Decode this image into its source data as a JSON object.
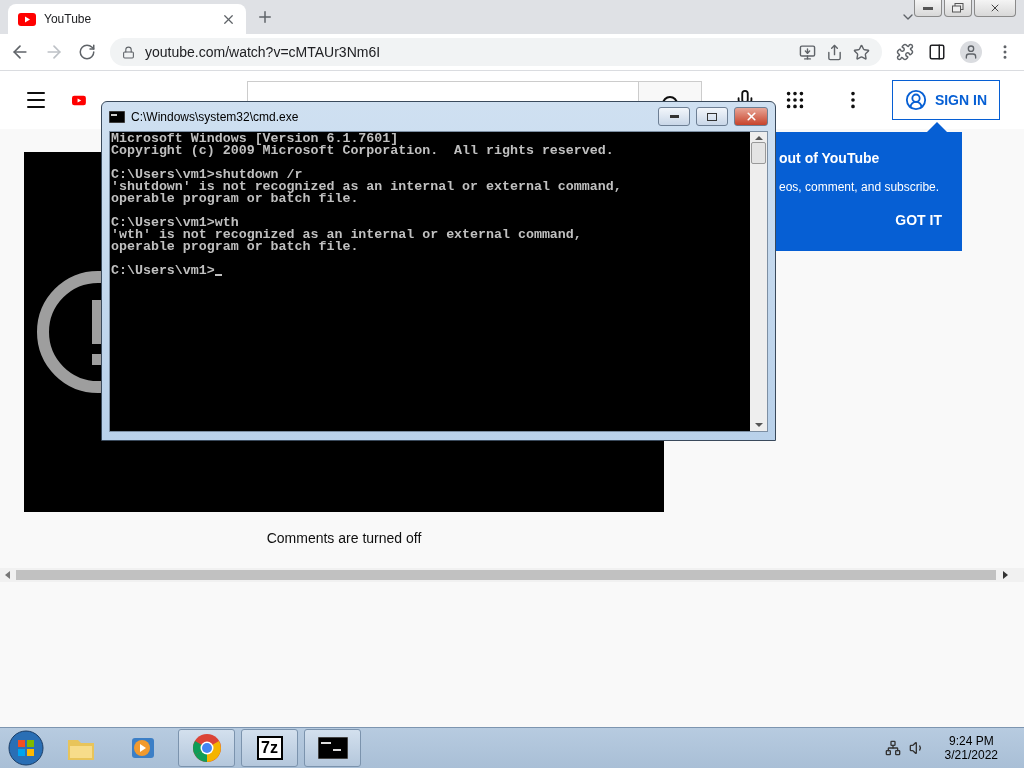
{
  "browser": {
    "tabs": [
      {
        "title": "YouTube",
        "selected": true
      }
    ],
    "address": "youtube.com/watch?v=cMTAUr3Nm6I"
  },
  "youtube": {
    "sign_in": "SIGN IN",
    "comments_note": "Comments are turned off",
    "tooltip": {
      "title": "out of YouTube",
      "body": "eos, comment, and subscribe.",
      "button": "GOT IT"
    }
  },
  "console": {
    "title": "C:\\Windows\\system32\\cmd.exe",
    "blocks": [
      [
        "Microsoft Windows [Version 6.1.7601]",
        "Copyright (c) 2009 Microsoft Corporation.  All rights reserved."
      ],
      [
        "C:\\Users\\vm1>shutdown /r",
        "'shutdown' is not recognized as an internal or external command,",
        "operable program or batch file."
      ],
      [
        "C:\\Users\\vm1>wth",
        "'wth' is not recognized as an internal or external command,",
        "operable program or batch file."
      ],
      [
        "C:\\Users\\vm1>"
      ]
    ]
  },
  "taskbar": {
    "apps": [
      {
        "kind": "folder",
        "open": false
      },
      {
        "kind": "media",
        "open": false
      },
      {
        "kind": "chrome",
        "open": true
      },
      {
        "kind": "archiver",
        "open": true,
        "label": "7z"
      },
      {
        "kind": "console",
        "open": true
      }
    ],
    "time": "9:24 PM",
    "date": "3/21/2022"
  }
}
